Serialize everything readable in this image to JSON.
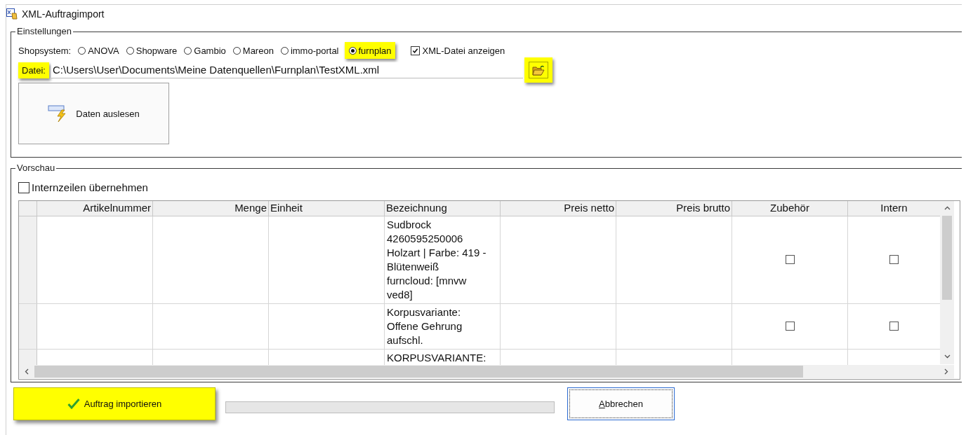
{
  "window": {
    "title": "XML-Auftragimport"
  },
  "settings": {
    "legend": "Einstellungen",
    "shopsystem_label": "Shopsystem:",
    "shopsystems": [
      {
        "label": "ANOVA",
        "selected": false,
        "highlighted": false
      },
      {
        "label": "Shopware",
        "selected": false,
        "highlighted": false
      },
      {
        "label": "Gambio",
        "selected": false,
        "highlighted": false
      },
      {
        "label": "Mareon",
        "selected": false,
        "highlighted": false
      },
      {
        "label": "immo-portal",
        "selected": false,
        "highlighted": false
      },
      {
        "label": "furnplan",
        "selected": true,
        "highlighted": true
      }
    ],
    "show_xml": {
      "label": "XML-Datei anzeigen",
      "checked": true
    },
    "file": {
      "label": "Datei:",
      "label_highlighted": true,
      "value": "C:\\Users\\User\\Documents\\Meine Datenquellen\\Furnplan\\TestXML.xml",
      "browse_highlighted": true
    },
    "read_button": {
      "label": "Daten auslesen"
    }
  },
  "preview": {
    "legend": "Vorschau",
    "internal_lines": {
      "label": "Internzeilen übernehmen",
      "checked": false
    },
    "table": {
      "columns": [
        {
          "label": "Artikelnummer",
          "kind": "text"
        },
        {
          "label": "Menge",
          "kind": "text"
        },
        {
          "label": "Einheit",
          "kind": "text"
        },
        {
          "label": "Bezeichnung",
          "kind": "description"
        },
        {
          "label": "Preis netto",
          "kind": "text"
        },
        {
          "label": "Preis brutto",
          "kind": "text"
        },
        {
          "label": "Zubehör",
          "kind": "checkbox"
        },
        {
          "label": "Intern",
          "kind": "checkbox"
        }
      ],
      "rows": [
        {
          "description": "Sudbrock\n4260595250006\nHolzart | Farbe: 419 -\nBlütenweiß\nfurncloud: [mnvw\nved8]",
          "checks": [
            false,
            false
          ]
        },
        {
          "description": "Korpusvariante:\nOffene Gehrung\naufschl.",
          "checks": [
            false,
            false
          ]
        },
        {
          "description": "KORPUSVARIANTE:"
        }
      ]
    }
  },
  "footer": {
    "import_button": {
      "label": "Auftrag importieren",
      "highlighted": true
    },
    "progress": {
      "level": 0
    },
    "cancel_button": {
      "label": "Abbrechen",
      "mnemonic_first_letter": true
    }
  }
}
